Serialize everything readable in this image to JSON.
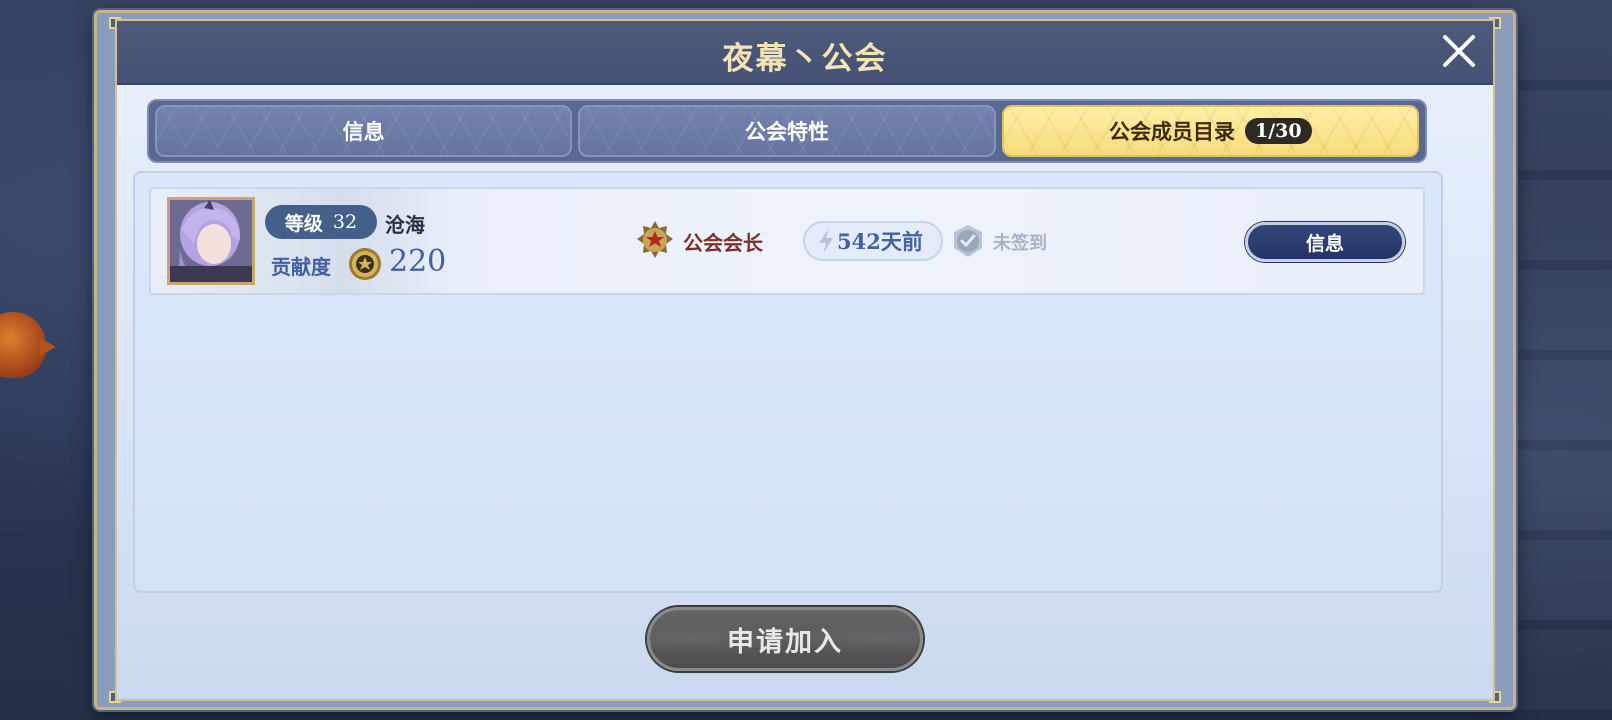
{
  "dialog": {
    "title": "夜幕丶公会"
  },
  "tabs": [
    {
      "label": "信息",
      "active": false
    },
    {
      "label": "公会特性",
      "active": false
    },
    {
      "label": "公会成员目录",
      "active": true,
      "badge": "1/30"
    }
  ],
  "members": [
    {
      "level_label": "等级",
      "level": "32",
      "name": "沧海",
      "contribution_label": "贡献度",
      "contribution": "220",
      "role": "公会会长",
      "last_online": "542天前",
      "signin_status": "未签到",
      "info_button": "信息"
    }
  ],
  "join_button": "申请加入",
  "colors": {
    "active_tab": "#f5dc7a",
    "title": "#f5e3b4",
    "accent_blue": "#4360a0",
    "role_red": "#7b2f2a"
  },
  "icons": [
    "close-icon",
    "avatar",
    "medal-coin-icon",
    "role-emblem-icon",
    "lightning-icon",
    "checkmark-icon"
  ]
}
